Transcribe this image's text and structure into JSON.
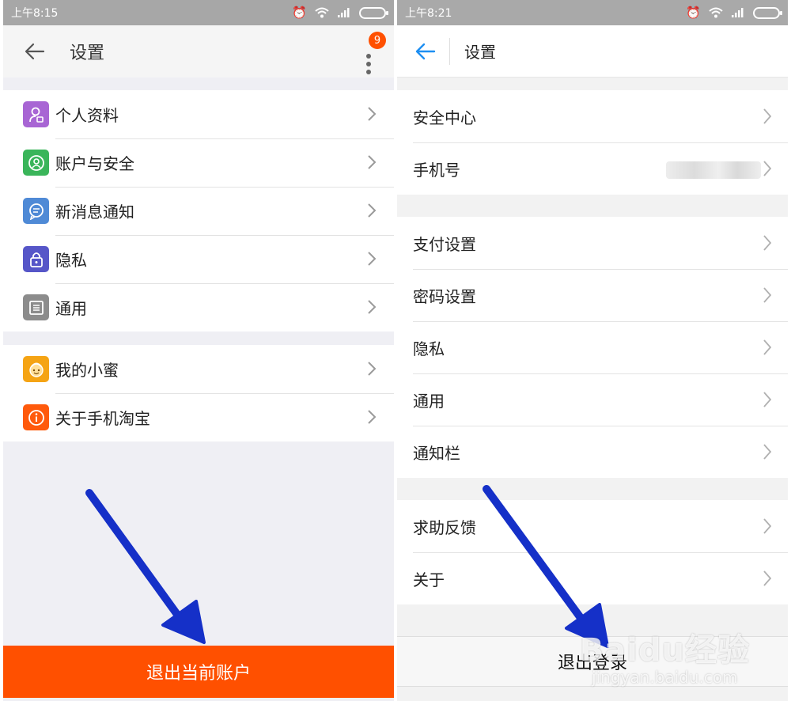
{
  "left": {
    "status": {
      "time": "上午8:15"
    },
    "header": {
      "title": "设置",
      "badge": "9"
    },
    "groups": [
      [
        {
          "label": "个人资料",
          "icon": "profile-icon",
          "color": "#a865d4"
        },
        {
          "label": "账户与安全",
          "icon": "account-security-icon",
          "color": "#3ab55a"
        },
        {
          "label": "新消息通知",
          "icon": "message-icon",
          "color": "#4f8ad6"
        },
        {
          "label": "隐私",
          "icon": "lock-icon",
          "color": "#5656c8"
        },
        {
          "label": "通用",
          "icon": "general-icon",
          "color": "#8c8c8c"
        }
      ],
      [
        {
          "label": "我的小蜜",
          "icon": "assistant-icon",
          "color": "#f5a414"
        },
        {
          "label": "关于手机淘宝",
          "icon": "info-icon",
          "color": "#ff5a0c"
        }
      ]
    ],
    "logout": "退出当前账户",
    "accent": "#ff5000"
  },
  "right": {
    "status": {
      "time": "上午8:21"
    },
    "header": {
      "title": "设置"
    },
    "groups": [
      [
        {
          "label": "安全中心"
        },
        {
          "label": "手机号"
        }
      ],
      [
        {
          "label": "支付设置"
        },
        {
          "label": "密码设置"
        },
        {
          "label": "隐私"
        },
        {
          "label": "通用"
        },
        {
          "label": "通知栏"
        }
      ],
      [
        {
          "label": "求助反馈"
        },
        {
          "label": "关于"
        }
      ]
    ],
    "logout": "退出登录",
    "accent": "#1e8ff2"
  },
  "annotation": {
    "arrow_color": "#1530c8"
  },
  "watermark": {
    "main": "Baidu经验",
    "sub": "jingyan.baidu.com"
  }
}
